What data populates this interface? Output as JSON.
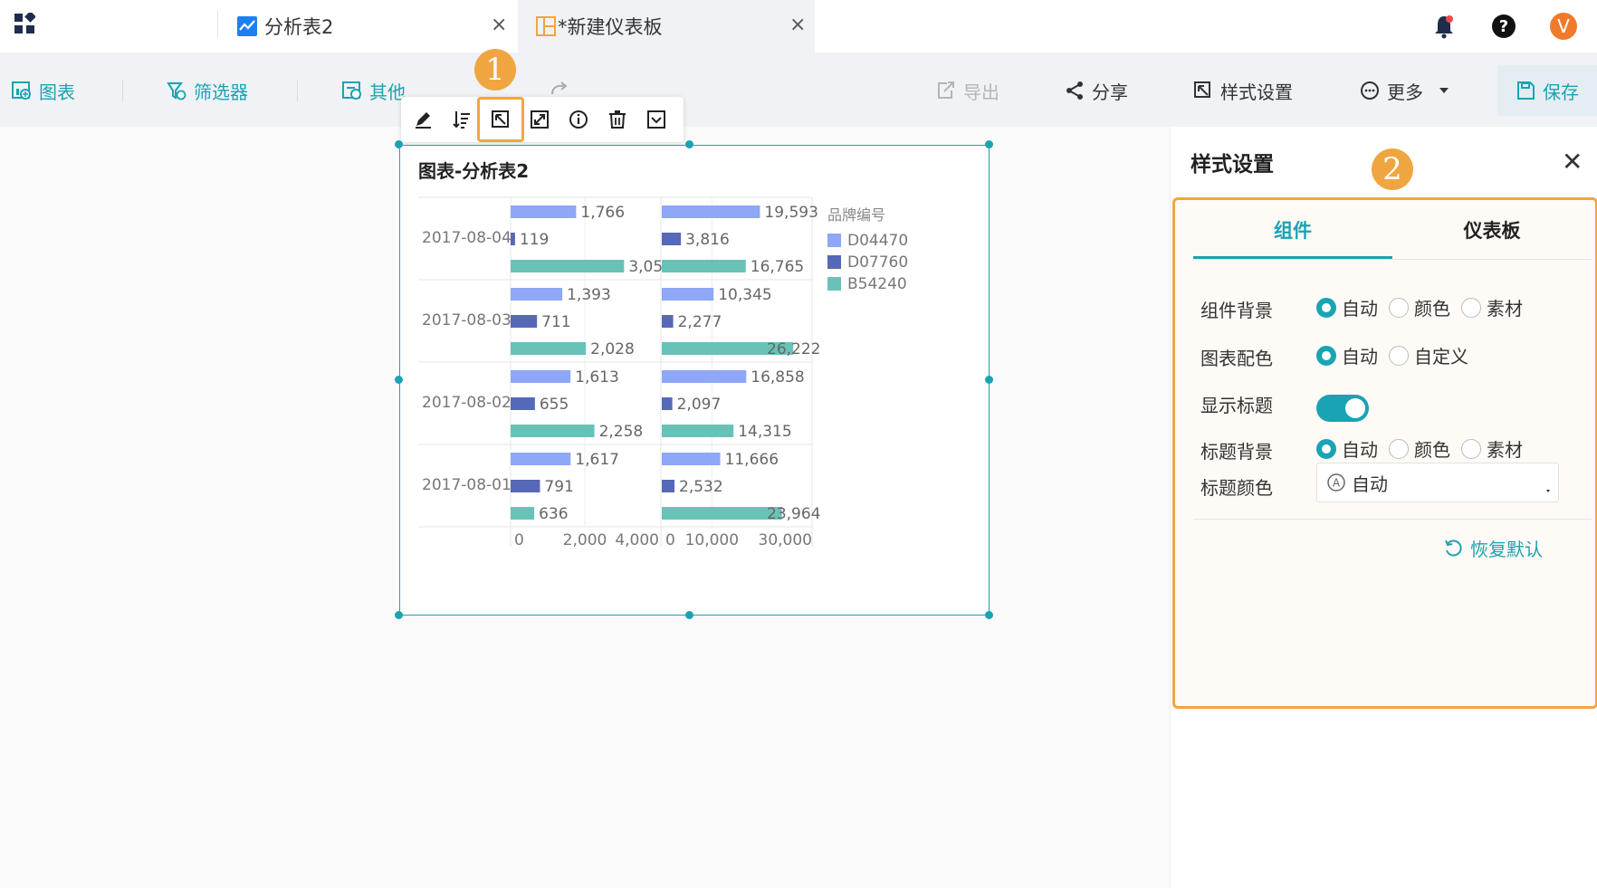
{
  "tabs": {
    "tab1": {
      "label": "分析表2"
    },
    "tab2": {
      "label": "*新建仪表板"
    },
    "close_glyph": "×"
  },
  "user": {
    "avatar_letter": "V",
    "avatar_color": "#f07a2c"
  },
  "toolbar": {
    "chart_label": "图表",
    "filter_label": "筛选器",
    "other_label": "其他",
    "export_label": "导出",
    "share_label": "分享",
    "style_label": "样式设置",
    "more_label": "更多",
    "save_label": "保存"
  },
  "badges": {
    "b1": "1",
    "b2": "2"
  },
  "chart_card": {
    "title": "图表-分析表2"
  },
  "chart_data": {
    "type": "bar",
    "orientation": "horizontal",
    "categories": [
      "2017-08-04",
      "2017-08-03",
      "2017-08-02",
      "2017-08-01"
    ],
    "legend_title": "品牌编号",
    "legend_placement": "right",
    "series": [
      {
        "name": "D04470",
        "color": "#8ea7f6",
        "left": [
          1766,
          1393,
          1613,
          1617
        ],
        "right": [
          19593,
          10345,
          16858,
          11666
        ]
      },
      {
        "name": "D07760",
        "color": "#5668b8",
        "left": [
          119,
          711,
          655,
          791
        ],
        "right": [
          3816,
          2277,
          2097,
          2532
        ]
      },
      {
        "name": "B54240",
        "color": "#69c2b8",
        "left": [
          3057,
          2028,
          2258,
          636
        ],
        "right": [
          16765,
          26222,
          14315,
          23964
        ]
      }
    ],
    "left_labels": [
      [
        "1,766",
        "119",
        "3,057"
      ],
      [
        "1,393",
        "711",
        "2,028"
      ],
      [
        "1,613",
        "655",
        "2,258"
      ],
      [
        "1,617",
        "791",
        "636"
      ]
    ],
    "right_labels": [
      [
        "19,593",
        "3,816",
        "16,765"
      ],
      [
        "10,345",
        "2,277",
        "26,222"
      ],
      [
        "16,858",
        "2,097",
        "14,315"
      ],
      [
        "11,666",
        "2,532",
        "23,964"
      ]
    ],
    "left_xlim": [
      0,
      4000
    ],
    "right_xlim": [
      0,
      30000
    ],
    "left_ticks": [
      "0",
      "2,000",
      "4,000"
    ],
    "right_ticks": [
      "0",
      "10,000",
      "30,000"
    ],
    "right_tick_values": [
      0,
      10000,
      30000
    ],
    "left_tick_values": [
      0,
      2000,
      4000
    ],
    "grid": true
  },
  "panel": {
    "title": "样式设置",
    "close_glyph": "✕",
    "tab_component": "组件",
    "tab_dashboard": "仪表板",
    "rows": {
      "bg_label": "组件背景",
      "palette_label": "图表配色",
      "show_title_label": "显示标题",
      "title_bg_label": "标题背景",
      "title_color_label": "标题颜色"
    },
    "opt_auto": "自动",
    "opt_color": "颜色",
    "opt_material": "素材",
    "opt_custom": "自定义",
    "title_color_value": "自动",
    "restore_label": "恢复默认"
  },
  "colors": {
    "accent": "#1aa3b3",
    "highlight": "#f0a640"
  }
}
